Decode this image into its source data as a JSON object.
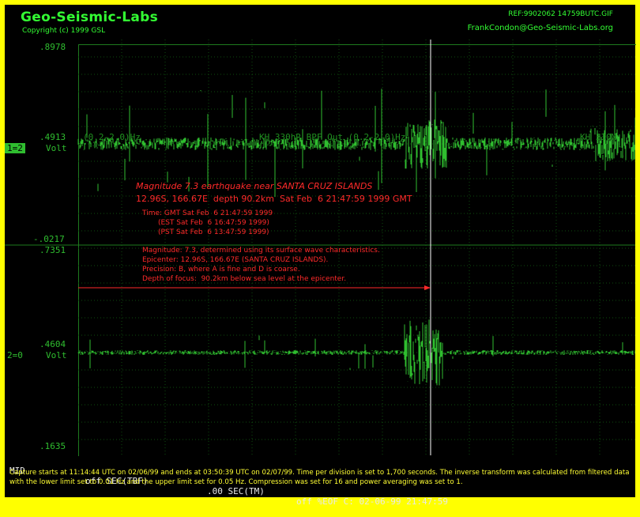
{
  "header": {
    "title": "Geo-Seismic-Labs",
    "copyright": "Copyright (c) 1999 GSL",
    "ref": "REF:9902062 14759BUTC.GIF",
    "email": "FrankCondon@Geo-Seismic-Labs.org"
  },
  "channel1": {
    "scale_top": ".8978",
    "scale_mid": ".4913",
    "scale_bottom": "-.0217",
    "label": "1=2",
    "unit": "Volt",
    "overlay_left": "(0.2-2.0)Hz",
    "overlay_mid": "KH 330hR BPF Out (0.2-2.0)Hz",
    "overlay_right": "KH 330M"
  },
  "channel2": {
    "scale_top": ".7351",
    "scale_mid": ".4604",
    "scale_bottom": ".1635",
    "label": "2=0",
    "unit": "Volt"
  },
  "event": {
    "title": "Magnitude 7.3 earthquake near SANTA CRUZ ISLANDS",
    "coords": "12.96S, 166.67E  depth 90.2km  Sat Feb  6 21:47:59 1999 GMT",
    "time_gmt": "Time: GMT Sat Feb  6 21:47:59 1999",
    "time_est": "(EST Sat Feb  6 16:47:59 1999)",
    "time_pst": "(PST Sat Feb  6 13:47:59 1999)",
    "detail_1": "Magnitude: 7.3, determined using its surface wave characteristics.",
    "detail_2": "Epicenter: 12.96S, 166.67E (SANTA CRUZ ISLANDS).",
    "detail_3": "Precision: B, where A is fine and D is coarse.",
    "detail_4": "Depth of focus:  90.2km below sea level at the epicenter."
  },
  "status": {
    "mid": "MID",
    "tbf": "off SEC(TBF)",
    "tm": ".00 SEC(TM)",
    "eof": "off %EOF C: 02-06-99 21:47:59"
  },
  "footer": {
    "text": "Capture starts at 11:14:44 UTC on 02/06/99 and ends at 03:50:39 UTC on 02/07/99. Time per division is set to 1,700 seconds. The inverse transform was calculated from filtered data with the lower limit set to 0.01 Hz and the upper limit set for 0.05 Hz. Compression was set for 16 and power averaging was set to 1."
  },
  "colors": {
    "frame": "#ffff00",
    "background": "#000000",
    "trace": "#2fbd2f",
    "annotation": "#ff2a2a",
    "footer_text": "#ffff33"
  }
}
